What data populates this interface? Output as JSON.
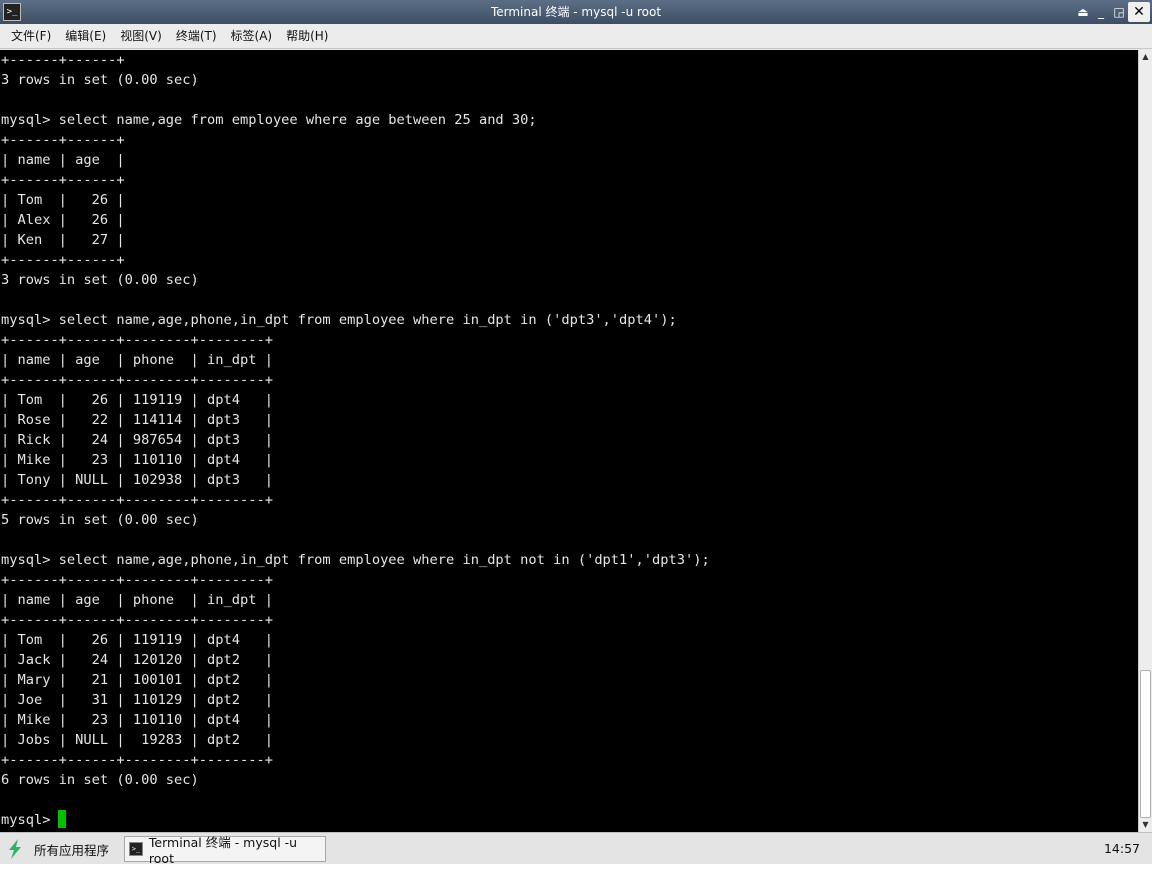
{
  "window": {
    "title": "Terminal 终端 - mysql -u root",
    "icon_glyph": ">_",
    "buttons": {
      "shade": "⏏",
      "minimize": "_",
      "maximize": "◲",
      "close": "✕"
    }
  },
  "menubar": {
    "items": [
      {
        "label": "文件(F)"
      },
      {
        "label": "编辑(E)"
      },
      {
        "label": "视图(V)"
      },
      {
        "label": "终端(T)"
      },
      {
        "label": "标签(A)"
      },
      {
        "label": "帮助(H)"
      }
    ]
  },
  "terminal": {
    "output": "+------+------+\n3 rows in set (0.00 sec)\n\nmysql> select name,age from employee where age between 25 and 30;\n+------+------+\n| name | age  |\n+------+------+\n| Tom  |   26 |\n| Alex |   26 |\n| Ken  |   27 |\n+------+------+\n3 rows in set (0.00 sec)\n\nmysql> select name,age,phone,in_dpt from employee where in_dpt in ('dpt3','dpt4');\n+------+------+--------+--------+\n| name | age  | phone  | in_dpt |\n+------+------+--------+--------+\n| Tom  |   26 | 119119 | dpt4   |\n| Rose |   22 | 114114 | dpt3   |\n| Rick |   24 | 987654 | dpt3   |\n| Mike |   23 | 110110 | dpt4   |\n| Tony | NULL | 102938 | dpt3   |\n+------+------+--------+--------+\n5 rows in set (0.00 sec)\n\nmysql> select name,age,phone,in_dpt from employee where in_dpt not in ('dpt1','dpt3');\n+------+------+--------+--------+\n| name | age  | phone  | in_dpt |\n+------+------+--------+--------+\n| Tom  |   26 | 119119 | dpt4   |\n| Jack |   24 | 120120 | dpt2   |\n| Mary |   21 | 100101 | dpt2   |\n| Joe  |   31 | 110129 | dpt2   |\n| Mike |   23 | 110110 | dpt4   |\n| Jobs | NULL |  19283 | dpt2   |\n+------+------+--------+--------+\n6 rows in set (0.00 sec)\n\n",
    "prompt": "mysql>",
    "cursor_color": "#00c000"
  },
  "scrollbar": {
    "up": "▲",
    "down": "▼"
  },
  "taskbar": {
    "start_label": "所有应用程序",
    "task_label": "Terminal 终端 - mysql -u root",
    "task_icon_glyph": ">_",
    "clock": "14:57"
  },
  "colors": {
    "accent_green": "#2fb36a",
    "titlebar": "#4a5b70"
  }
}
